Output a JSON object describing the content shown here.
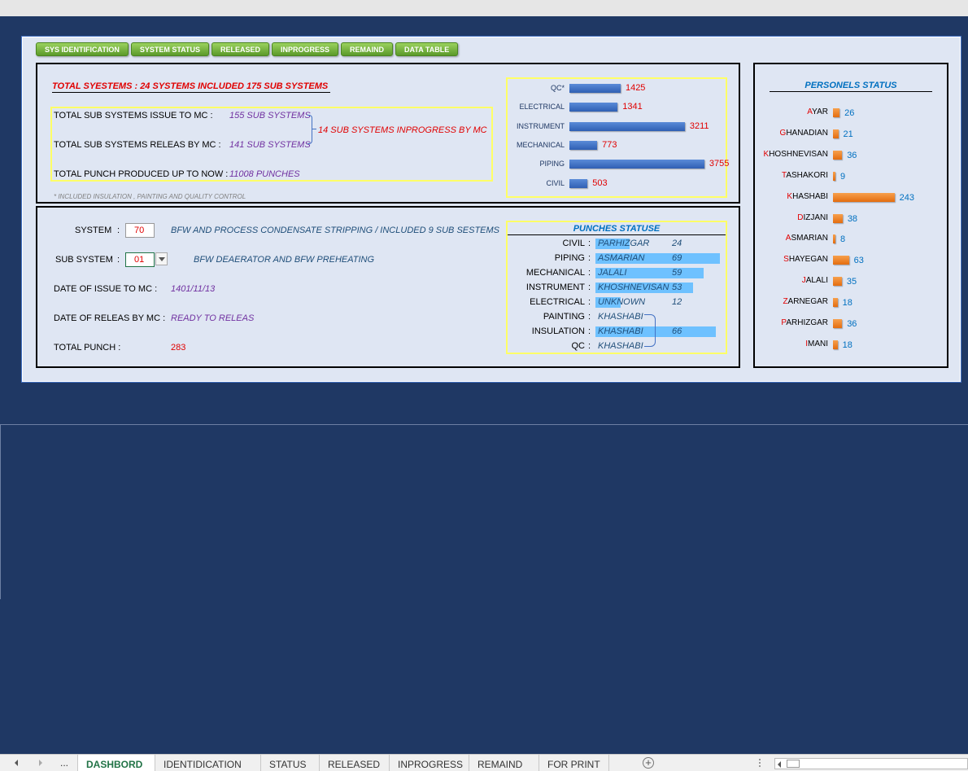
{
  "nav": [
    "SYS IDENTIFICATION",
    "SYSTEM STATUS",
    "RELEASED",
    "INPROGRESS",
    "REMAIND",
    "DATA TABLE"
  ],
  "summary": {
    "total_systems_label": "TOTAL SYESTEMS  :",
    "total_systems_value": "24 SYSTEMS INCLUDED 175 SUB SYSTEMS",
    "issue_label": "TOTAL SUB SYSTEMS ISSUE TO MC :",
    "issue_value": "155 SUB SYSTEMS",
    "release_label": "TOTAL SUB SYSTEMS RELEAS BY MC :",
    "release_value": "141 SUB SYSTEMS",
    "inprogress_note": "14 SUB SYSTEMS INPROGRESS BY MC",
    "punch_label": "TOTAL PUNCH PRODUCED UP TO NOW :",
    "punch_value": "11008 PUNCHES",
    "footnote": "* INCLUDED INSULATION , PAINTING AND QUALITY CONTROL"
  },
  "chart_data": [
    {
      "type": "bar",
      "categories": [
        "QC*",
        "ELECTRICAL",
        "INSTRUMENT",
        "MECHANICAL",
        "PIPING",
        "CIVIL"
      ],
      "values": [
        1425,
        1341,
        3211,
        773,
        3755,
        503
      ],
      "labels": [
        "1425",
        "1341",
        "3211",
        "773",
        "3755",
        "503"
      ],
      "xlim": [
        0,
        4300
      ],
      "orientation": "horizontal",
      "color": "#2f5fb3"
    },
    {
      "type": "bar",
      "title": "PERSONELS STATUS",
      "categories": [
        "AYAR",
        "GHANADIAN",
        "KHOSHNEVISAN",
        "TASHAKORI",
        "KHASHABI",
        "DIZJANI",
        "ASMARIAN",
        "SHAYEGAN",
        "JALALI",
        "ZARNEGAR",
        "PARHIZGAR",
        "IMANI"
      ],
      "values": [
        26,
        21,
        36,
        9,
        243,
        38,
        8,
        63,
        35,
        18,
        36,
        18
      ],
      "labels": [
        "26",
        "21",
        "36",
        "9",
        "243",
        "38",
        "8",
        "63",
        "35",
        "18",
        "36",
        "18"
      ],
      "xlim": [
        0,
        270
      ],
      "orientation": "horizontal",
      "color": "#e46d0f"
    }
  ],
  "detail": {
    "system_label": "SYSTEM",
    "colon": ":",
    "system_value": "70",
    "system_desc": "BFW AND PROCESS CONDENSATE STRIPPING / INCLUDED 9 SUB SESTEMS",
    "subsystem_label": "SUB SYSTEM",
    "subsystem_value": "01",
    "subsystem_desc": "BFW DEAERATOR AND BFW PREHEATING",
    "issue_date_label": "DATE OF ISSUE TO MC :",
    "issue_date_value": "1401/11/13",
    "release_date_label": "DATE OF RELEAS BY MC :",
    "release_date_value": "READY TO RELEAS",
    "total_punch_label": "TOTAL PUNCH :",
    "total_punch_value": "283"
  },
  "punches": {
    "title": "PUNCHES STATUSE",
    "rows": [
      {
        "disc": "CIVIL",
        "name": "PARHIZGAR",
        "count": "24",
        "hl": 0.27
      },
      {
        "disc": "PIPING",
        "name": "ASMARIAN",
        "count": "69",
        "hl": 0.98
      },
      {
        "disc": "MECHANICAL",
        "name": "JALALI",
        "count": "59",
        "hl": 0.85
      },
      {
        "disc": "INSTRUMENT",
        "name": "KHOSHNEVISAN",
        "count": "53",
        "hl": 0.77
      },
      {
        "disc": "ELECTRICAL",
        "name": "UNKNOWN",
        "count": "12",
        "hl": 0.2
      },
      {
        "disc": "PAINTING",
        "name": "KHASHABI",
        "count": "",
        "hl": 0
      },
      {
        "disc": "INSULATION",
        "name": "KHASHABI",
        "count": "66",
        "hl": 0.95
      },
      {
        "disc": "QC",
        "name": "KHASHABI",
        "count": "",
        "hl": 0
      }
    ]
  },
  "sheet_tabs": [
    "DASHBORD",
    "IDENTIDICATION",
    "STATUS",
    "RELEASED",
    "INPROGRESS",
    "REMAIND",
    "FOR PRINT"
  ],
  "sheet_more": "...",
  "add_sheet": "+"
}
